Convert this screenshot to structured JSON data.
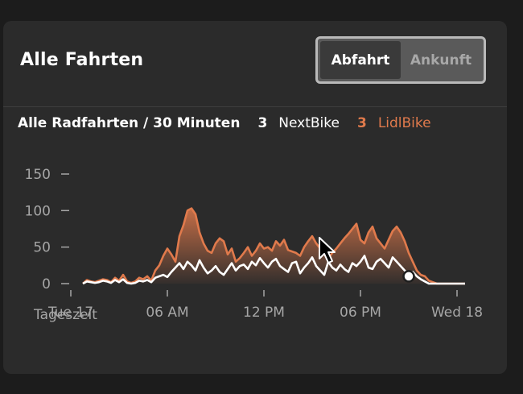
{
  "header": {
    "title": "Alle Fahrten",
    "toggle": {
      "options": [
        "Abfahrt",
        "Ankunft"
      ],
      "selected": "Abfahrt"
    }
  },
  "legend": {
    "title": "Alle Radfahrten / 30 Minuten",
    "items": [
      {
        "count": "3",
        "name": "NextBike",
        "color": "#ffffff"
      },
      {
        "count": "3",
        "name": "LidlBike",
        "color": "#e07a4c"
      }
    ]
  },
  "chart_data": {
    "type": "area",
    "title": "Alle Radfahrten / 30 Minuten",
    "xlabel": "Tageszeit",
    "ylabel": "",
    "ylim": [
      0,
      150
    ],
    "y_ticks": [
      0,
      50,
      100,
      150
    ],
    "x_ticks": [
      {
        "value": 0,
        "label": "Tue 17"
      },
      {
        "value": 6,
        "label": "06 AM"
      },
      {
        "value": 12,
        "label": "12 PM"
      },
      {
        "value": 18,
        "label": "06 PM"
      },
      {
        "value": 24,
        "label": "Wed 18"
      }
    ],
    "x_unit": "hours since Tue 17 00:00",
    "grid": false,
    "legend_position": "top",
    "series": [
      {
        "name": "LidlBike",
        "color": "#e07a4c",
        "x": [
          0.75,
          1,
          1.25,
          1.5,
          1.75,
          2,
          2.25,
          2.5,
          2.75,
          3,
          3.25,
          3.5,
          3.75,
          4,
          4.25,
          4.5,
          4.75,
          5,
          5.25,
          5.5,
          5.75,
          6,
          6.25,
          6.5,
          6.75,
          7,
          7.25,
          7.5,
          7.75,
          8,
          8.25,
          8.5,
          8.75,
          9,
          9.25,
          9.5,
          9.75,
          10,
          10.25,
          10.5,
          10.75,
          11,
          11.25,
          11.5,
          11.75,
          12,
          12.25,
          12.5,
          12.75,
          13,
          13.25,
          13.5,
          13.75,
          14,
          14.25,
          14.5,
          14.75,
          15,
          15.25,
          15.5,
          15.75,
          16,
          16.25,
          16.5,
          16.75,
          17,
          17.25,
          17.5,
          17.75,
          18,
          18.25,
          18.5,
          18.75,
          19,
          19.25,
          19.5,
          19.75,
          20,
          20.25,
          20.5,
          20.75,
          21,
          21.25,
          21.5,
          21.75,
          22,
          22.25,
          22.5,
          22.75,
          23,
          23.25,
          23.5,
          23.75,
          24,
          24.25,
          24.5
        ],
        "y": [
          0,
          5,
          3,
          2,
          4,
          6,
          5,
          2,
          8,
          4,
          12,
          3,
          1,
          3,
          8,
          6,
          10,
          4,
          18,
          25,
          38,
          48,
          40,
          30,
          65,
          80,
          100,
          103,
          95,
          70,
          55,
          45,
          42,
          55,
          62,
          58,
          40,
          48,
          30,
          35,
          42,
          50,
          38,
          45,
          55,
          48,
          50,
          45,
          58,
          52,
          60,
          46,
          44,
          42,
          38,
          50,
          58,
          65,
          55,
          48,
          40,
          35,
          42,
          48,
          55,
          62,
          68,
          75,
          82,
          60,
          55,
          70,
          78,
          62,
          55,
          48,
          60,
          72,
          78,
          70,
          58,
          42,
          30,
          18,
          12,
          10,
          4,
          2,
          0,
          0,
          0,
          0,
          0,
          0,
          0,
          0
        ]
      },
      {
        "name": "NextBike",
        "color": "#ffffff",
        "x": [
          0.75,
          1,
          1.25,
          1.5,
          1.75,
          2,
          2.25,
          2.5,
          2.75,
          3,
          3.25,
          3.5,
          3.75,
          4,
          4.25,
          4.5,
          4.75,
          5,
          5.25,
          5.5,
          5.75,
          6,
          6.25,
          6.5,
          6.75,
          7,
          7.25,
          7.5,
          7.75,
          8,
          8.25,
          8.5,
          8.75,
          9,
          9.25,
          9.5,
          9.75,
          10,
          10.25,
          10.5,
          10.75,
          11,
          11.25,
          11.5,
          11.75,
          12,
          12.25,
          12.5,
          12.75,
          13,
          13.25,
          13.5,
          13.75,
          14,
          14.25,
          14.5,
          14.75,
          15,
          15.25,
          15.5,
          15.75,
          16,
          16.25,
          16.5,
          16.75,
          17,
          17.25,
          17.5,
          17.75,
          18,
          18.25,
          18.5,
          18.75,
          19,
          19.25,
          19.5,
          19.75,
          20,
          20.25,
          20.5,
          20.75,
          21,
          21.25,
          21.5,
          21.75,
          22,
          22.25,
          22.5,
          22.75,
          23,
          23.25,
          23.5,
          23.75,
          24,
          24.25,
          24.5
        ],
        "y": [
          0,
          3,
          2,
          1,
          2,
          4,
          3,
          1,
          5,
          2,
          6,
          1,
          0,
          1,
          4,
          3,
          5,
          2,
          8,
          10,
          12,
          9,
          16,
          22,
          28,
          20,
          30,
          25,
          18,
          32,
          22,
          14,
          18,
          24,
          16,
          12,
          20,
          28,
          18,
          24,
          26,
          20,
          30,
          25,
          35,
          28,
          22,
          30,
          34,
          24,
          20,
          16,
          28,
          30,
          14,
          22,
          28,
          36,
          24,
          18,
          12,
          30,
          22,
          18,
          26,
          20,
          16,
          28,
          24,
          30,
          38,
          22,
          20,
          30,
          34,
          28,
          22,
          36,
          30,
          24,
          18,
          12,
          16,
          10,
          6,
          3,
          0,
          0,
          0,
          0,
          0,
          0,
          0,
          0,
          0,
          0
        ]
      }
    ],
    "marker": {
      "x": 21.0,
      "y": 10
    }
  },
  "cursor": {
    "icon": "mouse-pointer-icon"
  }
}
